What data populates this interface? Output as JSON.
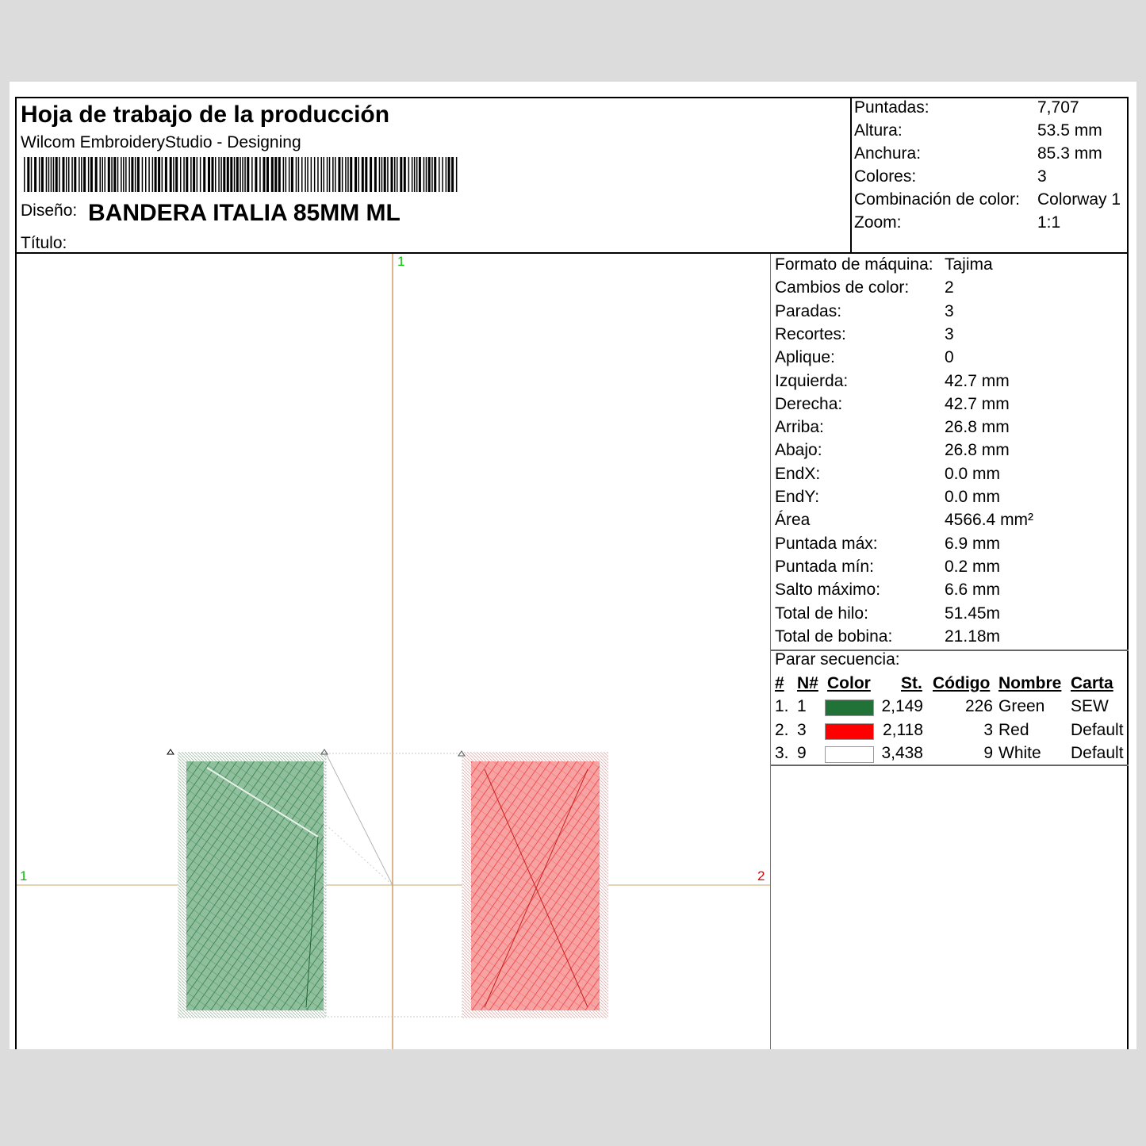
{
  "header": {
    "title": "Hoja de trabajo de la producción",
    "subtitle": "Wilcom EmbroideryStudio - Designing",
    "design_label": "Diseño:",
    "design_name": "BANDERA ITALIA 85MM ML",
    "title_label": "Título:"
  },
  "summary": [
    {
      "label": "Puntadas:",
      "value": "7,707"
    },
    {
      "label": "Altura:",
      "value": "53.5 mm"
    },
    {
      "label": "Anchura:",
      "value": "85.3 mm"
    },
    {
      "label": "Colores:",
      "value": "3"
    },
    {
      "label": "Combinación  de color:",
      "value": "Colorway 1"
    },
    {
      "label": "Zoom:",
      "value": "1:1"
    }
  ],
  "details": [
    {
      "label": "Formato de máquina:",
      "value": "Tajima"
    },
    {
      "label": "Cambios de color:",
      "value": "2"
    },
    {
      "label": "Paradas:",
      "value": "3"
    },
    {
      "label": "Recortes:",
      "value": "3"
    },
    {
      "label": "Aplique:",
      "value": "0"
    },
    {
      "label": "Izquierda:",
      "value": "42.7 mm"
    },
    {
      "label": "Derecha:",
      "value": "42.7 mm"
    },
    {
      "label": "Arriba:",
      "value": "26.8 mm"
    },
    {
      "label": "Abajo:",
      "value": "26.8 mm"
    },
    {
      "label": "EndX:",
      "value": "0.0 mm"
    },
    {
      "label": "EndY:",
      "value": "0.0 mm"
    },
    {
      "label": "Área",
      "value": "4566.4 mm²"
    },
    {
      "label": "Puntada máx:",
      "value": "6.9 mm"
    },
    {
      "label": "Puntada mín:",
      "value": "0.2 mm"
    },
    {
      "label": "Salto máximo:",
      "value": "6.6 mm"
    },
    {
      "label": "Total de hilo:",
      "value": "51.45m"
    },
    {
      "label": "Total de bobina:",
      "value": "21.18m"
    }
  ],
  "sequence": {
    "title": "Parar secuencia:",
    "headers": {
      "num": "#",
      "n": "N#",
      "color": "Color",
      "st": "St.",
      "code": "Código",
      "name": "Nombre",
      "chart": "Carta"
    },
    "rows": [
      {
        "num": "1.",
        "n": "1",
        "swatch": "#217237",
        "st": "2,149",
        "code": "226",
        "name": "Green",
        "chart": "SEW"
      },
      {
        "num": "2.",
        "n": "3",
        "swatch": "#ff0000",
        "st": "2,118",
        "code": "3",
        "name": "Red",
        "chart": "Default"
      },
      {
        "num": "3.",
        "n": "9",
        "swatch": "#ffffff",
        "st": "3,438",
        "code": "9",
        "name": "White",
        "chart": "Default"
      }
    ]
  },
  "canvas": {
    "axis_labels": {
      "top": "1",
      "left": "1",
      "right": "2"
    },
    "colors": {
      "green": "#2e7d46",
      "red": "#f03a3a",
      "axis": "#c8843c",
      "label": "#00c000",
      "label_right": "#e00000"
    }
  }
}
